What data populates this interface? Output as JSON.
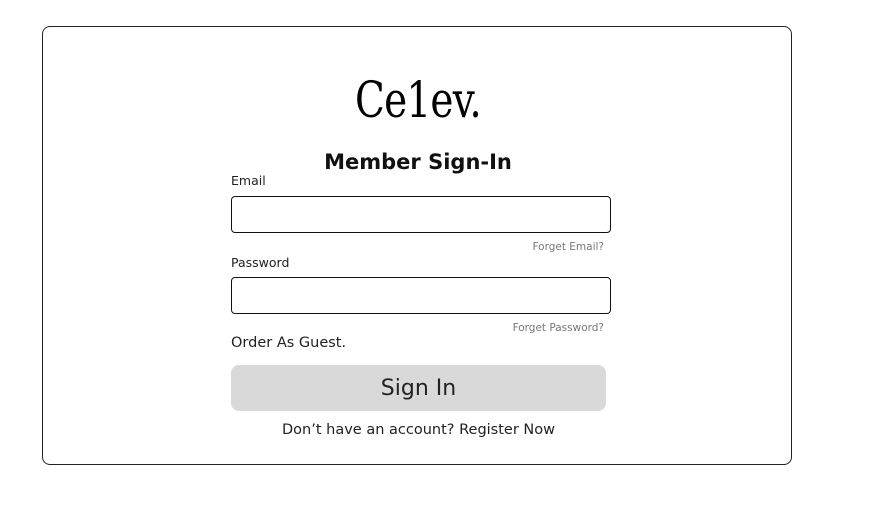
{
  "brand": {
    "logo_text": "Ce1ev."
  },
  "form": {
    "title": "Member Sign-In",
    "email_label": "Email",
    "email_value": "",
    "forgot_email": "Forget Email?",
    "password_label": "Password",
    "password_value": "",
    "forgot_password": "Forget Password?",
    "guest_link": "Order As Guest.",
    "signin_button": "Sign In",
    "register_prompt": "Don’t have an account?",
    "register_link": "Register Now"
  },
  "colors": {
    "button_bg": "#d9d9d9",
    "border": "#111111",
    "helper_text": "#777777"
  }
}
